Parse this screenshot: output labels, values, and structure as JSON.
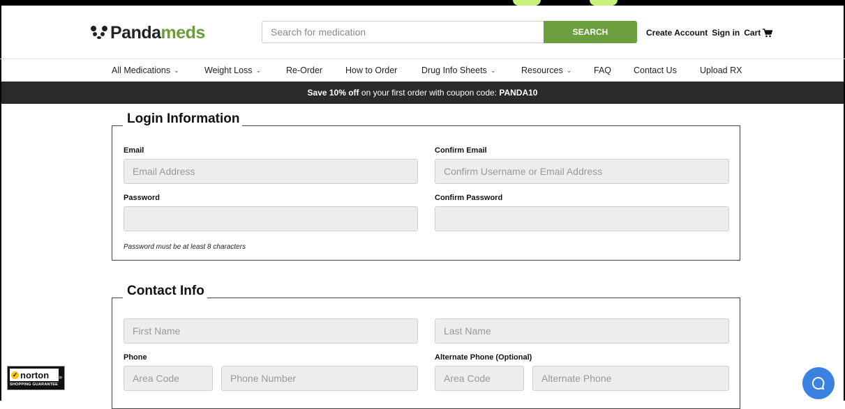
{
  "header": {
    "logo_part1": "Panda",
    "logo_part2": "meds",
    "search_placeholder": "Search for medication",
    "search_button": "SEARCH",
    "create_account": "Create Account",
    "sign_in": "Sign in",
    "cart": "Cart"
  },
  "nav": {
    "items": [
      {
        "label": "All Medications",
        "dropdown": true
      },
      {
        "label": "Weight Loss",
        "dropdown": true
      },
      {
        "label": "Re-Order",
        "dropdown": false
      },
      {
        "label": "How to Order",
        "dropdown": false
      },
      {
        "label": "Drug Info Sheets",
        "dropdown": true
      },
      {
        "label": "Resources",
        "dropdown": true
      },
      {
        "label": "FAQ",
        "dropdown": false
      },
      {
        "label": "Contact Us",
        "dropdown": false
      },
      {
        "label": "Upload RX",
        "dropdown": false
      }
    ]
  },
  "promo": {
    "bold1": "Save 10% off",
    "text": " on your first order with coupon code: ",
    "code": "PANDA10"
  },
  "login": {
    "title": "Login Information",
    "email_label": "Email",
    "email_placeholder": "Email Address",
    "confirm_email_label": "Confirm Email",
    "confirm_email_placeholder": "Confirm Username or Email Address",
    "password_label": "Password",
    "confirm_password_label": "Confirm Password",
    "password_hint": "Password must be at least 8 characters"
  },
  "contact": {
    "title": "Contact Info",
    "first_name_placeholder": "First Name",
    "last_name_placeholder": "Last Name",
    "phone_label": "Phone",
    "area_code_placeholder": "Area Code",
    "phone_number_placeholder": "Phone Number",
    "alt_phone_label": "Alternate Phone (Optional)",
    "alt_area_code_placeholder": "Area Code",
    "alt_phone_placeholder": "Alternate Phone"
  },
  "norton": {
    "brand": "norton",
    "subtitle": "SHOPPING GUARANTEE"
  },
  "colors": {
    "brand_green": "#6b9e3c",
    "promo_bg": "#2a2a2a",
    "chat_blue": "#3b82e0"
  }
}
